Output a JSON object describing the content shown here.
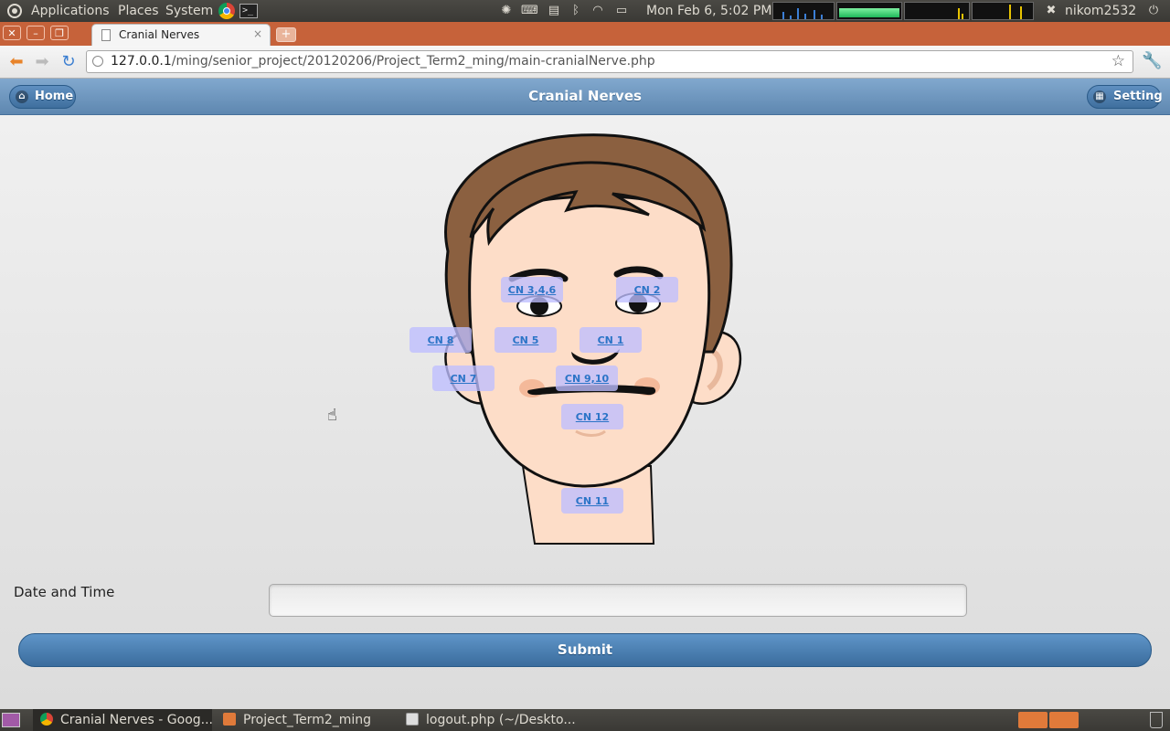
{
  "top_panel": {
    "menus": [
      "Applications",
      "Places",
      "System"
    ],
    "clock": "Mon Feb  6,  5:02 PM",
    "user": "nikom2532"
  },
  "browser": {
    "tab_title": "Cranial Nerves",
    "tab_close": "×",
    "new_tab": "+",
    "url_host": "127.0.0.1",
    "url_path": "/ming/senior_project/20120206/Project_Term2_ming/main-cranialNerve.php"
  },
  "header": {
    "title": "Cranial Nerves",
    "home_label": "Home",
    "setting_label": "Setting"
  },
  "nerves": [
    {
      "label": "CN 3,4,6"
    },
    {
      "label": "CN 2"
    },
    {
      "label": "CN 8"
    },
    {
      "label": "CN 5"
    },
    {
      "label": "CN 1"
    },
    {
      "label": "CN 7"
    },
    {
      "label": "CN 9,10"
    },
    {
      "label": "CN 12"
    },
    {
      "label": "CN 11"
    }
  ],
  "form": {
    "date_label": "Date and Time",
    "date_value": "",
    "submit_label": "Submit"
  },
  "taskbar": {
    "items": [
      {
        "label": "Cranial Nerves - Goog..."
      },
      {
        "label": "Project_Term2_ming"
      },
      {
        "label": "logout.php (~/Deskto..."
      }
    ]
  },
  "colors": {
    "header_blue": "#5e87b0",
    "button_blue": "#3a6c9d",
    "link_blue": "#2b74c7",
    "hotspot": "#bebeff",
    "title_bar": "#c6623a"
  }
}
